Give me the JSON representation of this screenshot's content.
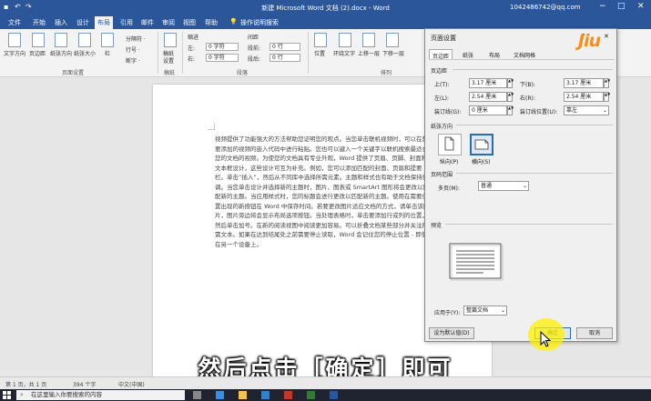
{
  "titlebar": {
    "title": "新建 Microsoft Word 文档 (2).docx  -  Word",
    "user": "1042486742@qq.com",
    "undo": "↶",
    "redo": "↷",
    "save": "▪",
    "min": "−",
    "max": "□",
    "close": "✕"
  },
  "tabs": [
    "文件",
    "开始",
    "插入",
    "设计",
    "布局",
    "引用",
    "邮件",
    "审阅",
    "视图",
    "帮助",
    "操作说明搜索"
  ],
  "ribbon": {
    "page_setup": {
      "label": "页面设置",
      "text_direction": "文字方向",
      "margins": "页边距",
      "orientation": "纸张方向",
      "size": "纸张大小",
      "columns": "栏",
      "breaks": "分隔符 ·",
      "line_numbers": "行号 ·",
      "hyphenation": "断字 ·"
    },
    "draft": {
      "line1": "稿纸",
      "line2": "设置",
      "label": "稿纸"
    },
    "indent": {
      "title": "缩进",
      "left": "左:",
      "right": "右:",
      "left_value": "0 字符",
      "right_value": "0 字符"
    },
    "spacing": {
      "title": "间距",
      "before": "段前:",
      "after": "段后:",
      "before_value": "0 行",
      "after_value": "0 行"
    },
    "paragraph_label": "段落",
    "arrange": {
      "position": "位置",
      "wrap": "环绕文字",
      "bring_forward": "上移一层",
      "send_backward": "下移一层",
      "label": "排列"
    }
  },
  "document": {
    "text": "视频提供了功能强大的方法帮助您证明您的观点。当您单击联机视频时，可以在想要添加的视频的嵌入代码中进行粘贴。您也可以键入一个关键字以联机搜索最适合您的文档的视频。为使您的文档具有专业外观，Word 提供了页眉、页脚、封面和文本框设计，这些设计可互为补充。例如，您可以添加匹配的封面、页眉和提要栏。单击“插入”，然后从不同库中选择所需元素。主题和样式也有助于文档保持协调。当您单击设计并选择新的主题时，图片、图表或 SmartArt 图形将会更改以匹配新的主题。当应用样式时，您的标题会进行更改以匹配新的主题。使用在需要位置出现的新按钮在 Word 中保存时间。若要更改图片适应文档的方式，请单击该图片，图片旁边将会显示布局选项按钮。当处理表格时，单击要添加行或列的位置，然后单击加号。在新的阅读视图中阅读更加容易。可以折叠文档某些部分并关注所需文本。如果在达到结尾处之前需要停止读取，Word 会记住您的停止位置 - 即使在另一个设备上。"
  },
  "dialog": {
    "title": "页面设置",
    "help": "?",
    "close": "✕",
    "tabs": [
      "页边距",
      "纸张",
      "布局",
      "文档网格"
    ],
    "margins_section": "页边距",
    "top_label": "上(T):",
    "top_value": "3.17 厘米",
    "bottom_label": "下(B):",
    "bottom_value": "3.17 厘米",
    "left_label": "左(L):",
    "left_value": "2.54 厘米",
    "right_label": "右(R):",
    "right_value": "2.54 厘米",
    "gutter_label": "装订线(G):",
    "gutter_value": "0 厘米",
    "gutter_pos_label": "装订线位置(U):",
    "gutter_pos_value": "靠左",
    "orientation_section": "纸张方向",
    "portrait": "纵向(P)",
    "landscape": "横向(S)",
    "pages_section": "页码范围",
    "multiple_label": "多页(M):",
    "multiple_value": "普通",
    "preview_section": "预览",
    "apply_label": "应用于(Y):",
    "apply_value": "整篇文档",
    "default_button": "设为默认值(D)",
    "ok_button": "确定",
    "cancel_button": "取消"
  },
  "subtitle": "然后点击［确定］即可",
  "logo": "Jiu",
  "status": {
    "page": "第 1 页，共 1 页",
    "words": "394 个字",
    "language": "中文(中国)"
  },
  "taskbar": {
    "search": "在这里输入你要搜索的内容"
  },
  "colors": {
    "accent": "#2b579a",
    "highlight": "#fff000",
    "subtitle": "#ffffff"
  }
}
